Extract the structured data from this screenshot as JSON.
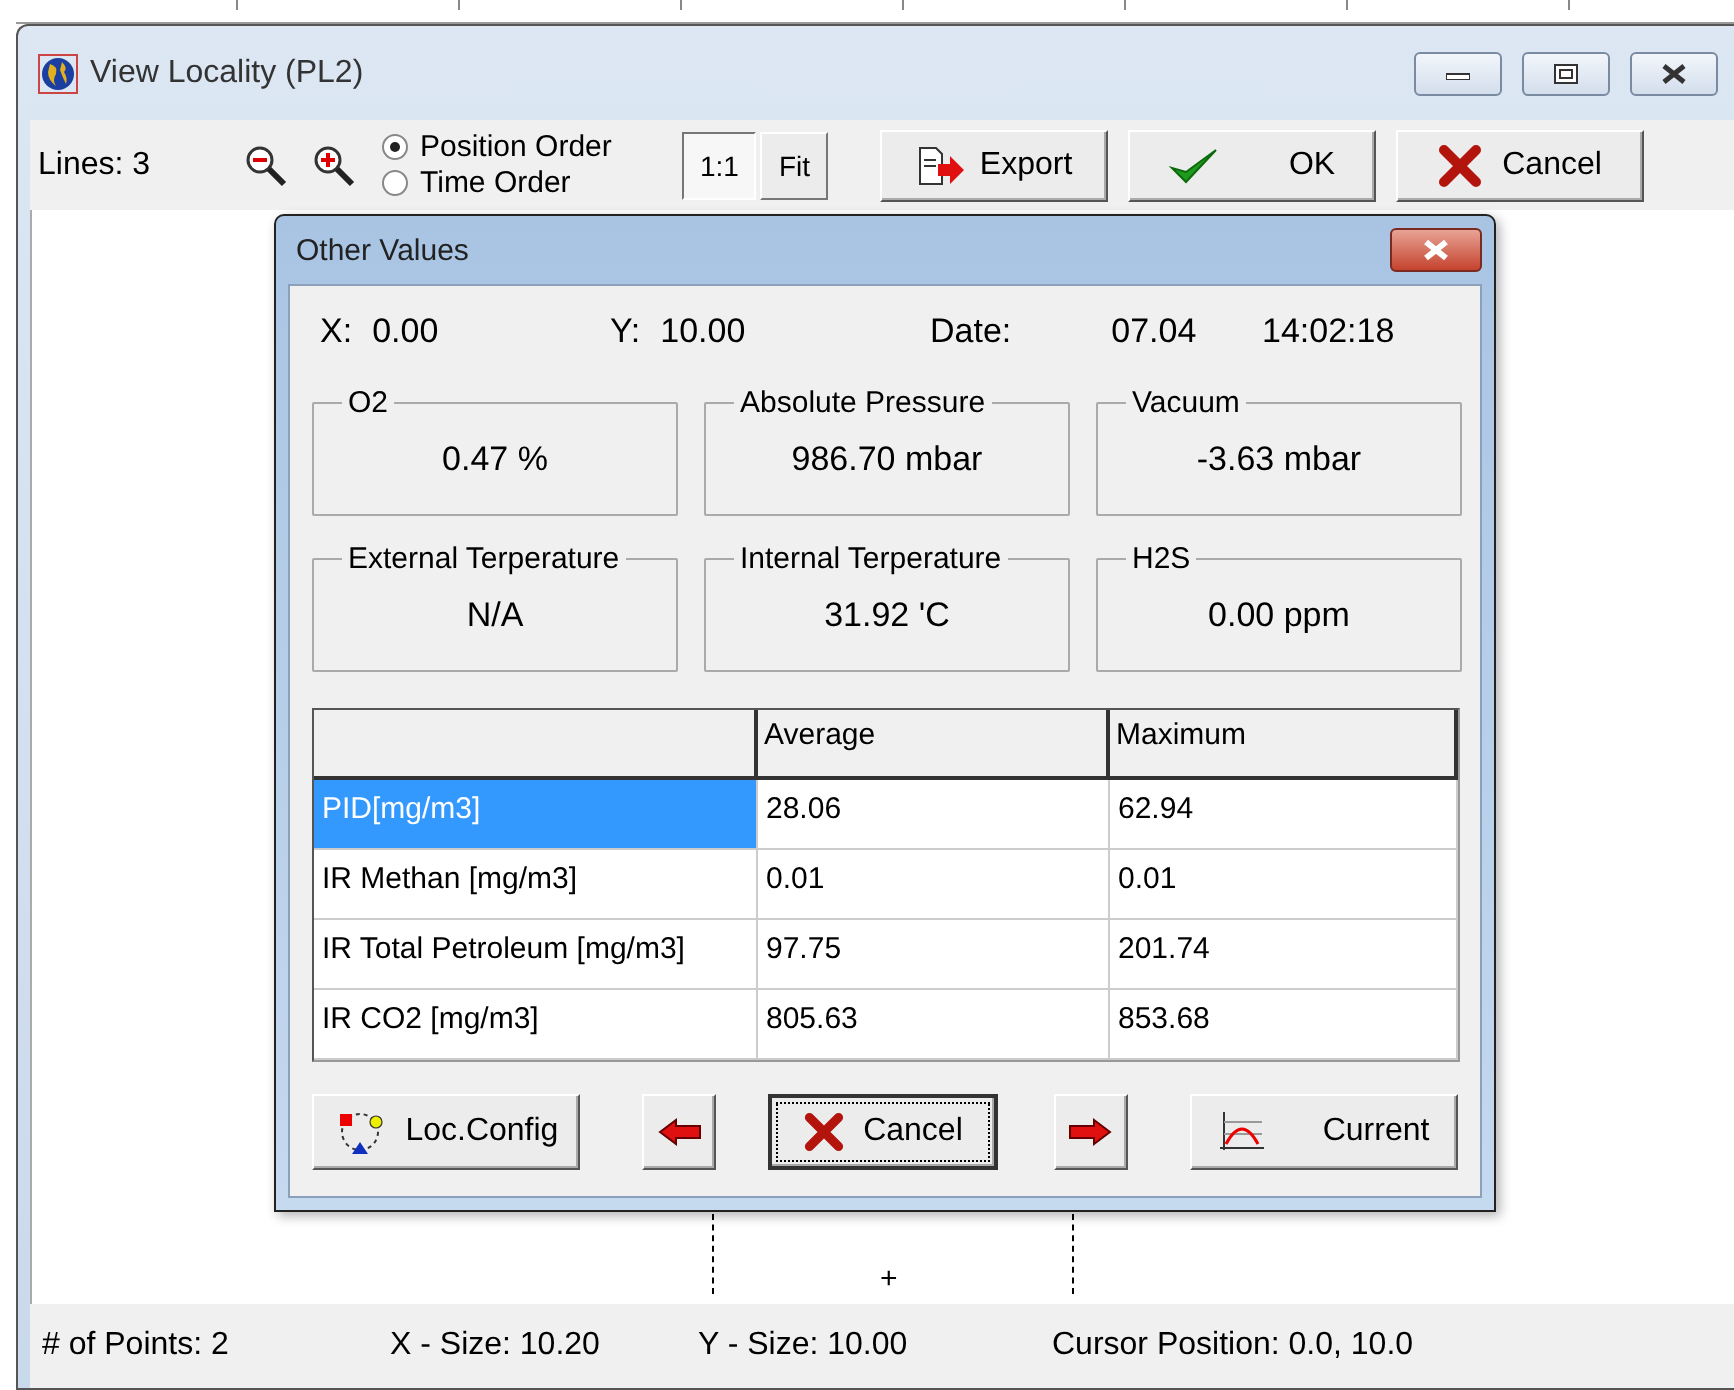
{
  "window": {
    "title": "View Locality (PL2)"
  },
  "toolbar": {
    "lines": "Lines: 3",
    "order_options": [
      {
        "label": "Position Order",
        "selected": true
      },
      {
        "label": "Time Order",
        "selected": false
      }
    ],
    "scale_buttons": [
      {
        "label": "1:1",
        "pressed": true
      },
      {
        "label": "Fit",
        "pressed": false
      }
    ],
    "buttons": [
      {
        "kind": "export",
        "label": "Export"
      },
      {
        "kind": "ok",
        "label": "OK"
      },
      {
        "kind": "cancel",
        "label": "Cancel"
      }
    ]
  },
  "canvas": {
    "marker": "+"
  },
  "dialog": {
    "title": "Other Values",
    "info": [
      {
        "label": "X:",
        "value": "0.00"
      },
      {
        "label": "Y:",
        "value": "10.00"
      },
      {
        "label": "Date:",
        "value": "07.04"
      }
    ],
    "time": "14:02:18",
    "groups": [
      {
        "label": "O2",
        "value": "0.47 %"
      },
      {
        "label": "Absolute Pressure",
        "value": "986.70 mbar"
      },
      {
        "label": "Vacuum",
        "value": "-3.63 mbar"
      },
      {
        "label": "External Terperature",
        "value": "N/A"
      },
      {
        "label": "Internal Terperature",
        "value": "31.92 'C"
      },
      {
        "label": "H2S",
        "value": "0.00 ppm"
      }
    ],
    "table": {
      "columns": [
        "Average",
        "Maximum"
      ],
      "rows": [
        {
          "name": "PID[mg/m3]",
          "average": "28.06",
          "maximum": "62.94",
          "selected": true
        },
        {
          "name": "IR Methan [mg/m3]",
          "average": "0.01",
          "maximum": "0.01",
          "selected": false
        },
        {
          "name": "IR Total Petroleum [mg/m3]",
          "average": "97.75",
          "maximum": "201.74",
          "selected": false
        },
        {
          "name": "IR CO2 [mg/m3]",
          "average": "805.63",
          "maximum": "853.68",
          "selected": false
        }
      ]
    },
    "buttons": [
      {
        "kind": "config",
        "label": "Loc.Config",
        "focused": false
      },
      {
        "kind": "prev",
        "focused": false
      },
      {
        "kind": "cancel",
        "label": "Cancel",
        "focused": true
      },
      {
        "kind": "next",
        "focused": false
      },
      {
        "kind": "chart",
        "label": "Current",
        "focused": false
      }
    ]
  },
  "status_bar": [
    "# of Points: 2",
    "X - Size: 10.20",
    "Y - Size: 10.00",
    "Cursor Position:  0.0, 10.0"
  ]
}
